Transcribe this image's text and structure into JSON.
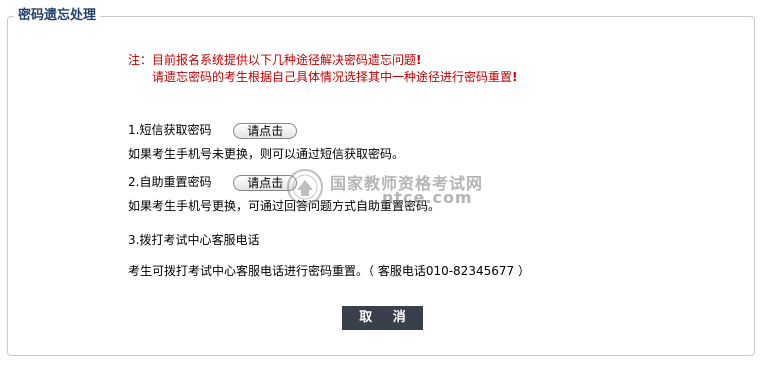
{
  "panel": {
    "title": "密码遗忘处理"
  },
  "notice": {
    "line1": "注：目前报名系统提供以下几种途径解决密码遗忘问题",
    "line2": "请遗忘密码的考生根据自己具体情况选择其中一种途径进行密码重置",
    "mark": "!"
  },
  "options": [
    {
      "label": "1.短信获取密码",
      "button": "请点击",
      "desc": "如果考生手机号未更换，则可以通过短信获取密码。"
    },
    {
      "label": "2.自助重置密码",
      "button": "请点击",
      "desc": "如果考生手机号更换，可通过回答问题方式自助重置密码。"
    },
    {
      "label": "3.拨打考试中心客服电话",
      "desc": "考生可拨打考试中心客服电话进行密码重置。（ 客服电话010-82345677 ）"
    }
  ],
  "cancel_label": "取 消",
  "watermark": {
    "text1": "国家教师资格考试网",
    "text2": "ntce.com"
  }
}
